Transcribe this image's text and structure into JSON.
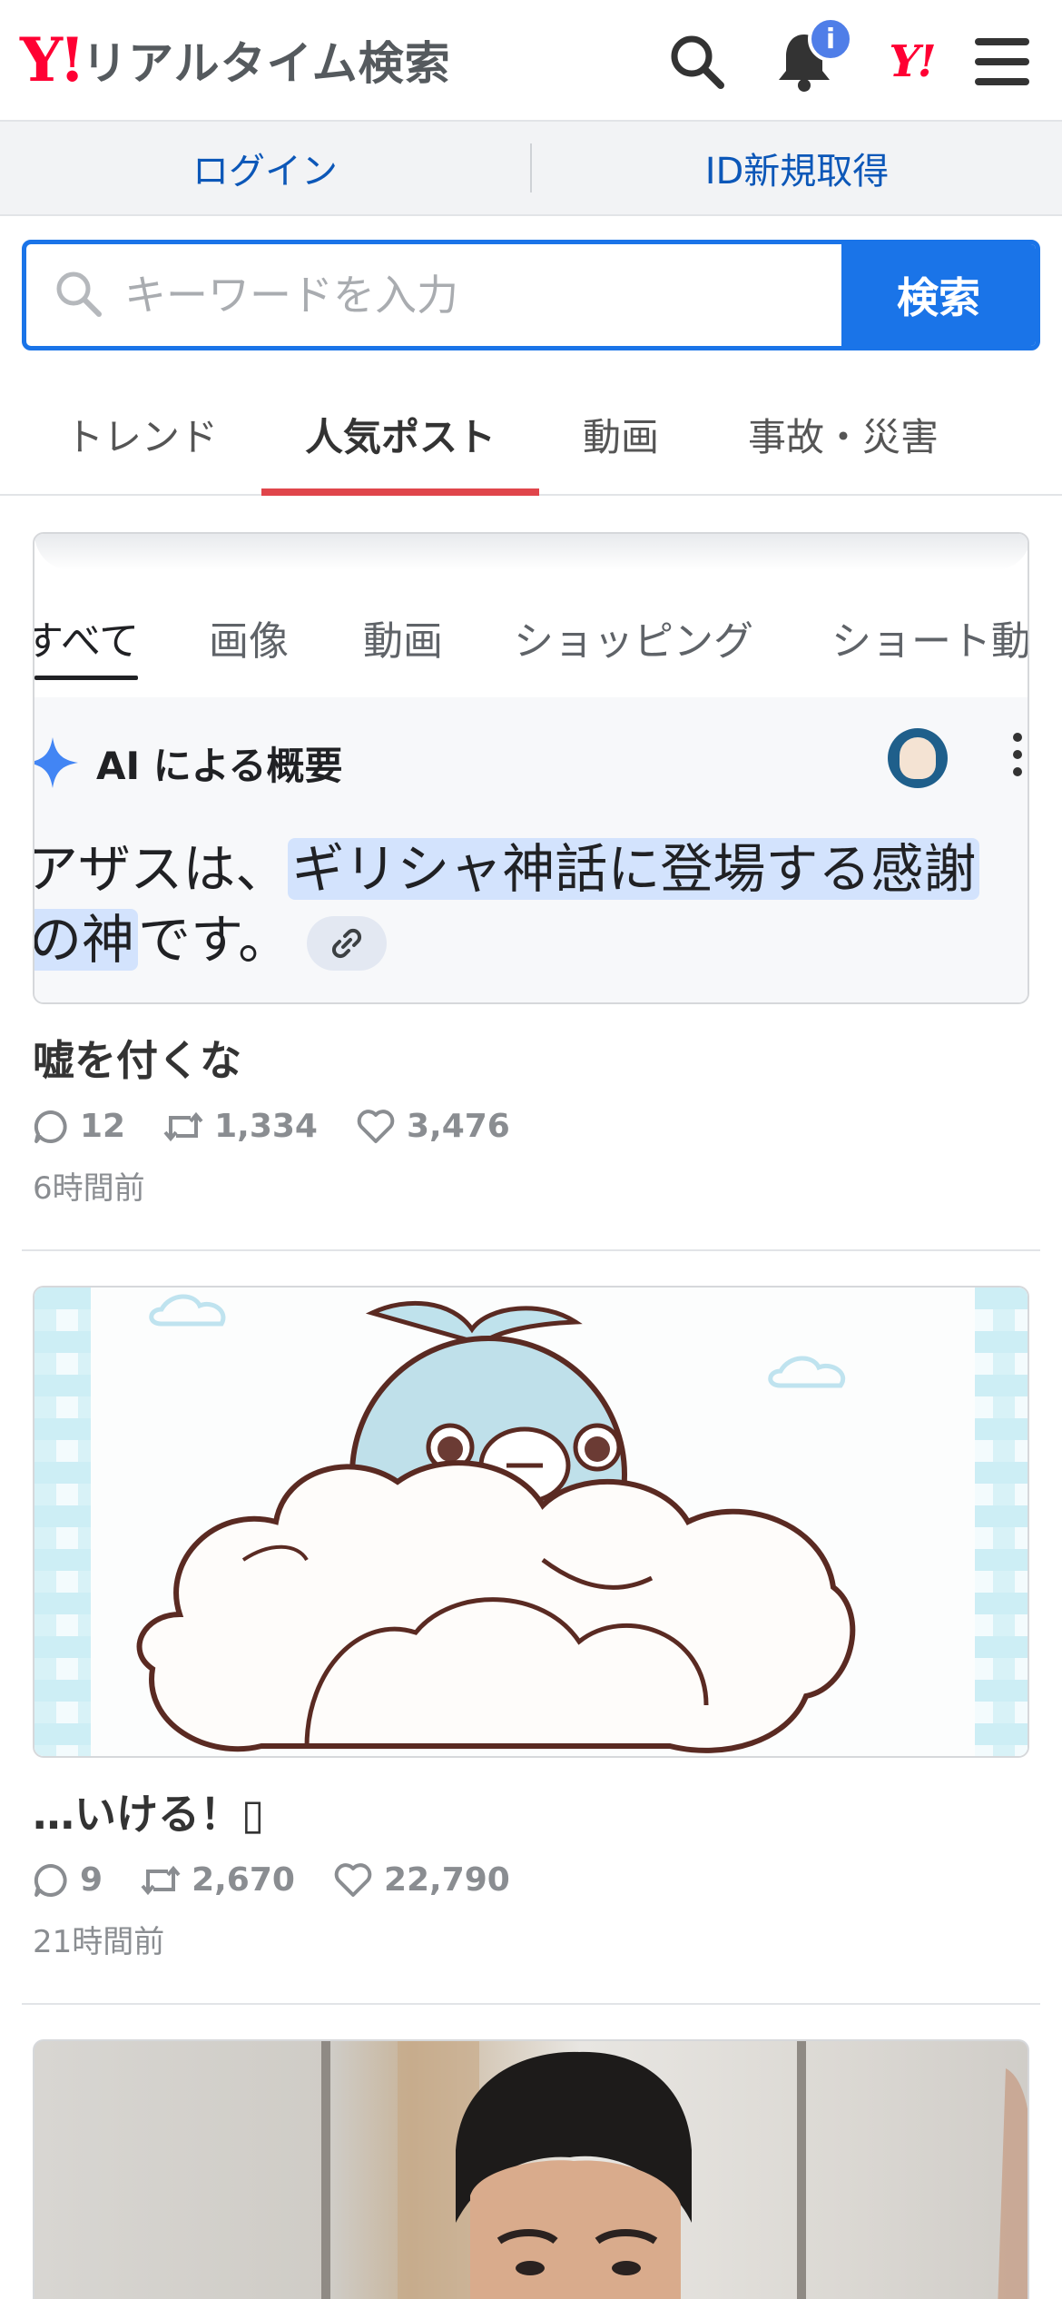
{
  "header": {
    "logo_mark": "Y!",
    "logo_text": "リアルタイム検索",
    "notification_badge": "i",
    "yahoo_mark": "Y!",
    "icons": [
      "search-icon",
      "bell-icon",
      "yahoo-logo-icon",
      "menu-icon"
    ]
  },
  "account": {
    "login": "ログイン",
    "signup": "ID新規取得"
  },
  "search": {
    "placeholder": "キーワードを入力",
    "button": "検索"
  },
  "tabs": [
    {
      "label": "トレンド",
      "active": false
    },
    {
      "label": "人気ポスト",
      "active": true
    },
    {
      "label": "動画",
      "active": false
    },
    {
      "label": "事故・災害",
      "active": false
    }
  ],
  "posts": [
    {
      "image": {
        "tabs": [
          "すべて",
          "画像",
          "動画",
          "ショッピング",
          "ショート動"
        ],
        "ai_heading": "AI による概要",
        "line1_plain": "アザスは、",
        "line1_highlight": "ギリシャ神話に登場する感謝",
        "line2_highlight": "の神",
        "line2_plain": "です。"
      },
      "title": "嘘を付くな",
      "replies": "12",
      "reposts": "1,334",
      "likes": "3,476",
      "time": "6時間前"
    },
    {
      "title": "…いける！▯",
      "replies": "9",
      "reposts": "2,670",
      "likes": "22,790",
      "time": "21時間前"
    },
    {
      "media": "photo"
    }
  ],
  "colors": {
    "brand_red": "#ff0033",
    "accent_blue": "#1a74e8",
    "tab_underline": "#e0454b",
    "badge_blue": "#4f7ee8"
  }
}
